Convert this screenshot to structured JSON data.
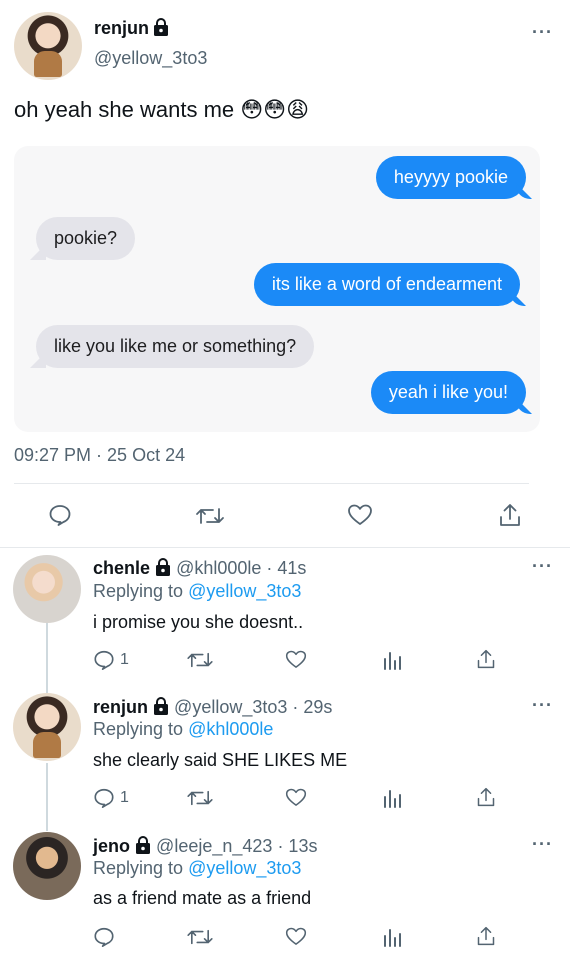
{
  "main_tweet": {
    "author_name": "renjun",
    "author_handle": "@yellow_3to3",
    "text": "oh yeah she wants me 😳😳😩",
    "timestamp": "09:27 PM · 25 Oct 24"
  },
  "chat": [
    {
      "side": "out",
      "text": "heyyyy pookie"
    },
    {
      "side": "in",
      "text": "pookie?"
    },
    {
      "side": "out",
      "text": "its like a word of endearment"
    },
    {
      "side": "in",
      "text": "like you like me or something?"
    },
    {
      "side": "out",
      "text": "yeah i like you!"
    }
  ],
  "replies": [
    {
      "name": "chenle",
      "handle": "@khl000le",
      "time": "· 41s",
      "replying_label": "Replying to",
      "replying_to": "@yellow_3to3",
      "text": "i promise you she doesnt..",
      "reply_count": "1"
    },
    {
      "name": "renjun",
      "handle": "@yellow_3to3",
      "time": "· 29s",
      "replying_label": "Replying to",
      "replying_to": "@khl000le",
      "text": "she clearly said SHE LIKES ME",
      "reply_count": "1"
    },
    {
      "name": "jeno",
      "handle": "@leeje_n_423",
      "time": "· 13s",
      "replying_label": "Replying to",
      "replying_to": "@yellow_3to3",
      "text": "as a friend mate as a friend",
      "reply_count": ""
    }
  ],
  "more_glyph": "···",
  "colors": {
    "outgoing_bubble": "#1b8af7",
    "incoming_bubble": "#e4e4ea",
    "mention": "#1d9bf0",
    "muted": "#536471"
  }
}
